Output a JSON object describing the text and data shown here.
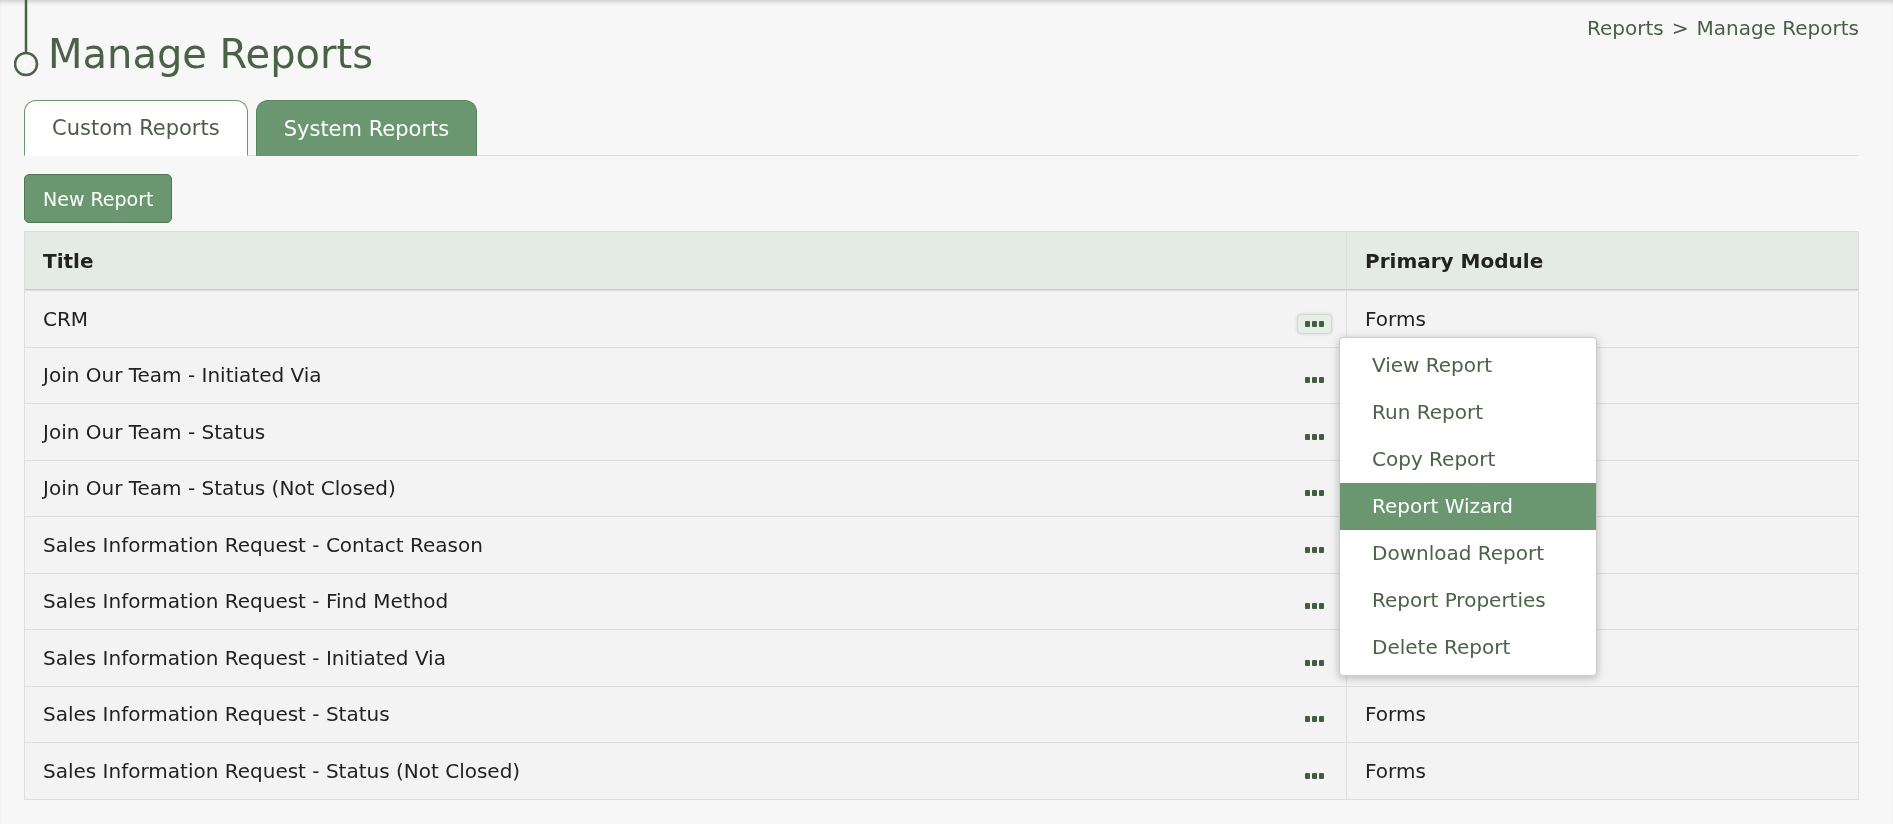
{
  "breadcrumb": [
    {
      "label": "Reports",
      "separator": ">"
    },
    {
      "label": "Manage Reports"
    }
  ],
  "page_title": "Manage Reports",
  "tabs": [
    {
      "label": "Custom Reports",
      "selected": true
    },
    {
      "label": "System Reports",
      "selected": false
    }
  ],
  "new_button": "New Report",
  "table": {
    "columns": [
      "Title",
      "Primary Module"
    ],
    "rows": [
      {
        "title": "CRM",
        "module": "Forms",
        "menu_open": true
      },
      {
        "title": "Join Our Team - Initiated Via",
        "menu_open": false
      },
      {
        "title": "Join Our Team - Status",
        "menu_open": false
      },
      {
        "title": "Join Our Team - Status (Not Closed)",
        "menu_open": false
      },
      {
        "title": "Sales Information Request - Contact Reason",
        "menu_open": false
      },
      {
        "title": "Sales Information Request - Find Method",
        "menu_open": false
      },
      {
        "title": "Sales Information Request - Initiated Via",
        "menu_open": false
      },
      {
        "title": "Sales Information Request - Status",
        "module": "Forms",
        "menu_open": false
      },
      {
        "title": "Sales Information Request - Status (Not Closed)",
        "module": "Forms",
        "menu_open": false
      }
    ]
  },
  "context_menu": [
    {
      "label": "View Report",
      "selected": false
    },
    {
      "label": "Run Report",
      "selected": false
    },
    {
      "label": "Copy Report",
      "selected": false
    },
    {
      "label": "Report Wizard",
      "selected": true
    },
    {
      "label": "Download Report",
      "selected": false
    },
    {
      "label": "Report Properties",
      "selected": false
    },
    {
      "label": "Delete Report",
      "selected": false
    }
  ]
}
